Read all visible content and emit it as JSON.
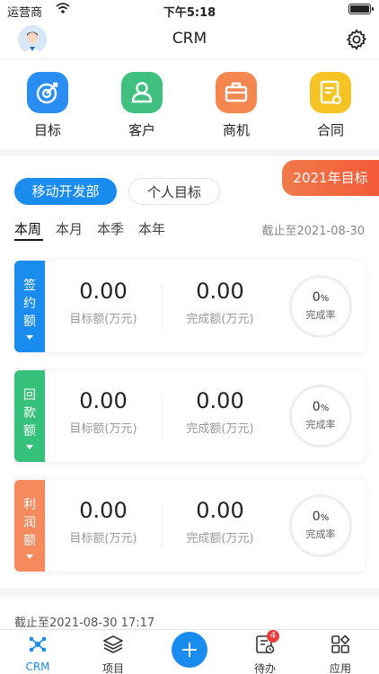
{
  "status_bar": {
    "carrier": "运营商",
    "time": "下午5:18"
  },
  "nav": {
    "title": "CRM"
  },
  "quick_actions": [
    {
      "label": "目标",
      "icon": "target-icon",
      "color": "#2a8df2"
    },
    {
      "label": "客户",
      "icon": "person-icon",
      "color": "#3fc07e"
    },
    {
      "label": "商机",
      "icon": "briefcase-icon",
      "color": "#f4864f"
    },
    {
      "label": "合同",
      "icon": "contract-icon",
      "color": "#f5c323"
    }
  ],
  "targets": {
    "year_badge": "2021年目标",
    "dept_pill": "移动开发部",
    "personal_pill": "个人目标",
    "tabs": [
      "本周",
      "本月",
      "本季",
      "本年"
    ],
    "active_tab": "本周",
    "deadline": "截止至2021-08-30",
    "cards": [
      {
        "tag": [
          "签",
          "约",
          "额"
        ],
        "color": "#1a8cf0",
        "target_value": "0.00",
        "target_caption": "目标额(万元)",
        "done_value": "0.00",
        "done_caption": "完成额(万元)",
        "pct": "0",
        "pct_unit": "%",
        "rate_label": "完成率"
      },
      {
        "tag": [
          "回",
          "款",
          "额"
        ],
        "color": "#36c17a",
        "target_value": "0.00",
        "target_caption": "目标额(万元)",
        "done_value": "0.00",
        "done_caption": "完成额(万元)",
        "pct": "0",
        "pct_unit": "%",
        "rate_label": "完成率"
      },
      {
        "tag": [
          "利",
          "润",
          "额"
        ],
        "color": "#f68a5c",
        "target_value": "0.00",
        "target_caption": "目标额(万元)",
        "done_value": "0.00",
        "done_caption": "完成额(万元)",
        "pct": "0",
        "pct_unit": "%",
        "rate_label": "完成率"
      }
    ]
  },
  "footer": {
    "updated": "截止至2021-08-30 17:17"
  },
  "tabbar": {
    "items": [
      {
        "label": "CRM",
        "icon": "crm-icon",
        "active": true
      },
      {
        "label": "项目",
        "icon": "layers-icon",
        "active": false
      },
      {
        "label": "",
        "icon": "plus-icon",
        "active": false
      },
      {
        "label": "待办",
        "icon": "todo-icon",
        "active": false,
        "badge": "4"
      },
      {
        "label": "应用",
        "icon": "apps-icon",
        "active": false
      }
    ]
  }
}
